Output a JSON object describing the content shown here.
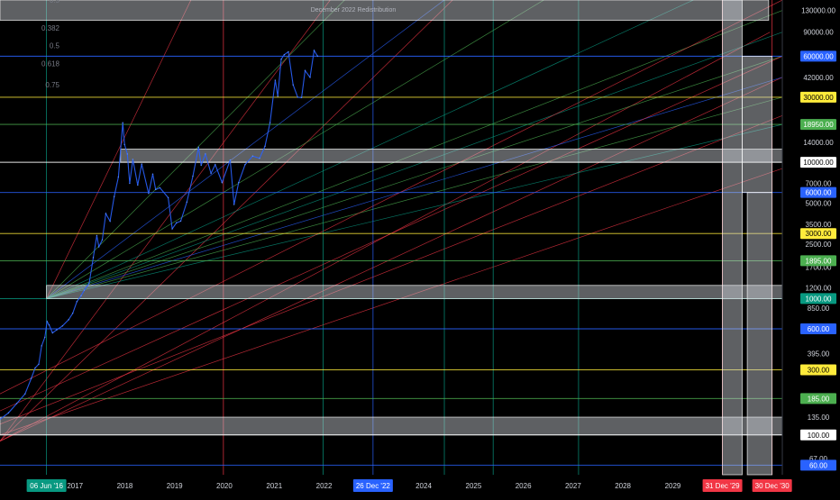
{
  "chart_data": {
    "type": "line",
    "yscale": "log",
    "title": "",
    "annotation": "December 2022 Redistribution",
    "ylim": [
      51,
      155000
    ],
    "xlim": [
      "2015-07-01",
      "2031-03-15"
    ],
    "y_ticks": [
      "130000.00",
      "90000.00",
      "60000.00",
      "42000.00",
      "30000.00",
      "18950.00",
      "14000.00",
      "10000.00",
      "7000.00",
      "6000.00",
      "5000.00",
      "3500.00",
      "3000.00",
      "2500.00",
      "1895.00",
      "1700.00",
      "1200.00",
      "1000.00",
      "850.00",
      "600.00",
      "395.00",
      "300.00",
      "185.00",
      "135.00",
      "100.00",
      "67.00",
      "60.00"
    ],
    "x_ticks": [
      {
        "label": "2017",
        "date": "2017-01-01"
      },
      {
        "label": "2018",
        "date": "2018-01-01"
      },
      {
        "label": "2019",
        "date": "2019-01-01"
      },
      {
        "label": "2020",
        "date": "2020-01-01"
      },
      {
        "label": "2021",
        "date": "2021-01-01"
      },
      {
        "label": "2022",
        "date": "2022-01-01"
      },
      {
        "label": "2024",
        "date": "2024-01-01"
      },
      {
        "label": "2025",
        "date": "2025-01-01"
      },
      {
        "label": "2026",
        "date": "2026-01-01"
      },
      {
        "label": "2027",
        "date": "2027-01-01"
      },
      {
        "label": "2028",
        "date": "2028-01-01"
      },
      {
        "label": "2029",
        "date": "2029-01-01"
      }
    ],
    "x_left_cut_label": "201",
    "x_markers": [
      {
        "label": "06 Jun '16",
        "date": "2016-06-06",
        "color": "#089981"
      },
      {
        "label": "26 Dec '22",
        "date": "2022-12-26",
        "color": "#2962ff"
      },
      {
        "label": "31 Dec '29",
        "date": "2029-12-31",
        "color": "#f23645"
      },
      {
        "label": "30 Dec '30",
        "date": "2030-12-30",
        "color": "#f23645"
      }
    ],
    "price_levels": [
      {
        "label": "60000.00",
        "value": 60000,
        "color": "#2962ff",
        "text_color": "#ffffff"
      },
      {
        "label": "30000.00",
        "value": 30000,
        "color": "#ffeb3b",
        "text_color": "#000000"
      },
      {
        "label": "18950.00",
        "value": 18950,
        "color": "#4caf50",
        "text_color": "#ffffff"
      },
      {
        "label": "10000.00",
        "value": 10000,
        "color": "#ffffff",
        "text_color": "#000000"
      },
      {
        "label": "6000.00",
        "value": 6000,
        "color": "#2962ff",
        "text_color": "#ffffff"
      },
      {
        "label": "3000.00",
        "value": 3000,
        "color": "#ffeb3b",
        "text_color": "#000000"
      },
      {
        "label": "1895.00",
        "value": 1895,
        "color": "#4caf50",
        "text_color": "#ffffff"
      },
      {
        "label": "1000.00",
        "value": 1000,
        "color": "#089981",
        "text_color": "#ffffff"
      },
      {
        "label": "600.00",
        "value": 600,
        "color": "#2962ff",
        "text_color": "#ffffff"
      },
      {
        "label": "300.00",
        "value": 300,
        "color": "#ffeb3b",
        "text_color": "#000000"
      },
      {
        "label": "185.00",
        "value": 185,
        "color": "#4caf50",
        "text_color": "#ffffff"
      },
      {
        "label": "100.00",
        "value": 100,
        "color": "#ffffff",
        "text_color": "#000000"
      },
      {
        "label": "60.00",
        "value": 60,
        "color": "#2962ff",
        "text_color": "#ffffff"
      }
    ],
    "fib_labels": [
      {
        "text": "0.5",
        "value": 155000
      },
      {
        "text": "0.382",
        "value": 97000
      },
      {
        "text": "0.5",
        "value": 72000
      },
      {
        "text": "0.618",
        "value": 53000
      },
      {
        "text": "0.75",
        "value": 37000
      }
    ],
    "zones": [
      {
        "x0": "2015-07-01",
        "x1": "2030-12-05",
        "y0": 110000,
        "y1": 155000
      },
      {
        "x0": "2017-12-01",
        "x1": "2031-03-15",
        "y0": 10000,
        "y1": 12500
      },
      {
        "x0": "2016-06-06",
        "x1": "2031-03-15",
        "y0": 1000,
        "y1": 1250
      },
      {
        "x0": "2015-07-01",
        "x1": "2031-03-15",
        "y0": 100,
        "y1": 135
      },
      {
        "x0": "2029-12-31",
        "x1": "2030-05-25",
        "y0": 51,
        "y1": 155000
      },
      {
        "x0": "2030-05-25",
        "x1": "2030-12-30",
        "y0": 6000,
        "y1": 60000
      },
      {
        "x0": "2030-07-01",
        "x1": "2030-12-30",
        "y0": 51,
        "y1": 6000
      }
    ],
    "vertical_lines": [
      {
        "date": "2016-06-06",
        "color": "#089981"
      },
      {
        "date": "2019-12-25",
        "color": "#f23645"
      },
      {
        "date": "2021-12-25",
        "color": "#089981"
      },
      {
        "date": "2022-12-26",
        "color": "#2962ff"
      },
      {
        "date": "2024-06-01",
        "color": "#089981"
      },
      {
        "date": "2025-05-25",
        "color": "#089981"
      },
      {
        "date": "2027-02-10",
        "color": "#089981"
      },
      {
        "date": "2029-12-31",
        "color": "#f23645"
      },
      {
        "date": "2030-12-30",
        "color": "#f23645"
      }
    ],
    "fan_lines": [
      {
        "x0": "2015-07-01",
        "y0": 90,
        "x1": "2022-02-15",
        "y1": 155000,
        "color": "#f23645"
      },
      {
        "x0": "2015-07-01",
        "y0": 90,
        "x1": "2024-08-01",
        "y1": 155000,
        "color": "#f23645"
      },
      {
        "x0": "2015-07-01",
        "y0": 90,
        "x1": "2030-12-15",
        "y1": 90000,
        "color": "#f23645"
      },
      {
        "x0": "2015-07-01",
        "y0": 90,
        "x1": "2031-03-15",
        "y1": 42000,
        "color": "#f23645"
      },
      {
        "x0": "2016-06-06",
        "y0": 1000,
        "x1": "2019-05-01",
        "y1": 155000,
        "color": "#f23645"
      },
      {
        "x0": "2016-06-06",
        "y0": 1000,
        "x1": "2022-06-01",
        "y1": 155000,
        "color": "#4caf50"
      },
      {
        "x0": "2016-06-06",
        "y0": 1000,
        "x1": "2024-06-01",
        "y1": 155000,
        "color": "#2962ff"
      },
      {
        "x0": "2016-06-06",
        "y0": 1000,
        "x1": "2026-06-01",
        "y1": 155000,
        "color": "#4caf50"
      },
      {
        "x0": "2016-06-06",
        "y0": 1000,
        "x1": "2029-06-01",
        "y1": 155000,
        "color": "#089981"
      },
      {
        "x0": "2016-06-06",
        "y0": 1000,
        "x1": "2031-03-15",
        "y1": 130000,
        "color": "#4caf50"
      },
      {
        "x0": "2016-06-06",
        "y0": 1000,
        "x1": "2031-03-15",
        "y1": 90000,
        "color": "#089981"
      },
      {
        "x0": "2016-06-06",
        "y0": 1000,
        "x1": "2031-03-15",
        "y1": 60000,
        "color": "#4caf50"
      },
      {
        "x0": "2016-06-06",
        "y0": 1000,
        "x1": "2031-03-15",
        "y1": 42000,
        "color": "#2962ff"
      },
      {
        "x0": "2016-06-06",
        "y0": 1000,
        "x1": "2031-03-15",
        "y1": 30000,
        "color": "#4caf50"
      },
      {
        "x0": "2016-06-06",
        "y0": 1000,
        "x1": "2031-03-15",
        "y1": 18950,
        "color": "#089981"
      },
      {
        "x0": "2015-07-01",
        "y0": 200,
        "x1": "2031-03-15",
        "y1": 155000,
        "color": "#f23645"
      },
      {
        "x0": "2015-07-01",
        "y0": 150,
        "x1": "2031-03-15",
        "y1": 60000,
        "color": "#f23645"
      },
      {
        "x0": "2015-07-01",
        "y0": 120,
        "x1": "2031-03-15",
        "y1": 22000,
        "color": "#f23645"
      },
      {
        "x0": "2015-07-01",
        "y0": 100,
        "x1": "2031-03-15",
        "y1": 9000,
        "color": "#f23645"
      }
    ],
    "price_series": [
      [
        "2015-07-01",
        130
      ],
      [
        "2015-09-01",
        145
      ],
      [
        "2015-11-01",
        170
      ],
      [
        "2016-01-01",
        200
      ],
      [
        "2016-02-15",
        260
      ],
      [
        "2016-03-15",
        310
      ],
      [
        "2016-04-10",
        330
      ],
      [
        "2016-05-01",
        450
      ],
      [
        "2016-05-25",
        520
      ],
      [
        "2016-06-10",
        680
      ],
      [
        "2016-06-25",
        640
      ],
      [
        "2016-07-20",
        560
      ],
      [
        "2016-08-20",
        590
      ],
      [
        "2016-10-01",
        630
      ],
      [
        "2016-11-15",
        700
      ],
      [
        "2016-12-15",
        780
      ],
      [
        "2017-01-15",
        950
      ],
      [
        "2017-02-15",
        1050
      ],
      [
        "2017-03-10",
        1150
      ],
      [
        "2017-04-15",
        1300
      ],
      [
        "2017-05-15",
        2000
      ],
      [
        "2017-06-10",
        2900
      ],
      [
        "2017-06-25",
        2400
      ],
      [
        "2017-07-20",
        2700
      ],
      [
        "2017-08-15",
        4200
      ],
      [
        "2017-09-15",
        3700
      ],
      [
        "2017-10-15",
        5600
      ],
      [
        "2017-11-15",
        7800
      ],
      [
        "2017-12-17",
        19500
      ],
      [
        "2017-12-30",
        13500
      ],
      [
        "2018-01-20",
        11500
      ],
      [
        "2018-02-06",
        7000
      ],
      [
        "2018-03-01",
        10500
      ],
      [
        "2018-04-06",
        6800
      ],
      [
        "2018-05-05",
        9700
      ],
      [
        "2018-06-25",
        5900
      ],
      [
        "2018-07-25",
        8200
      ],
      [
        "2018-08-15",
        6300
      ],
      [
        "2018-09-15",
        6500
      ],
      [
        "2018-11-15",
        5500
      ],
      [
        "2018-12-15",
        3250
      ],
      [
        "2019-01-15",
        3600
      ],
      [
        "2019-02-15",
        3700
      ],
      [
        "2019-04-01",
        5100
      ],
      [
        "2019-05-15",
        7900
      ],
      [
        "2019-06-26",
        12900
      ],
      [
        "2019-07-15",
        9500
      ],
      [
        "2019-08-15",
        11500
      ],
      [
        "2019-09-25",
        8300
      ],
      [
        "2019-10-26",
        9600
      ],
      [
        "2019-12-15",
        7100
      ],
      [
        "2020-02-13",
        10400
      ],
      [
        "2020-03-12",
        4900
      ],
      [
        "2020-04-15",
        7100
      ],
      [
        "2020-06-01",
        9600
      ],
      [
        "2020-07-27",
        11100
      ],
      [
        "2020-09-15",
        10700
      ],
      [
        "2020-10-25",
        13100
      ],
      [
        "2020-12-01",
        19500
      ],
      [
        "2021-01-08",
        40000
      ],
      [
        "2021-01-27",
        30500
      ],
      [
        "2021-02-21",
        57000
      ],
      [
        "2021-03-15",
        61500
      ],
      [
        "2021-04-14",
        64500
      ],
      [
        "2021-05-19",
        37000
      ],
      [
        "2021-06-22",
        30000
      ],
      [
        "2021-07-20",
        29800
      ],
      [
        "2021-08-15",
        47000
      ],
      [
        "2021-09-20",
        42000
      ],
      [
        "2021-10-20",
        66000
      ],
      [
        "2021-11-15",
        60000
      ]
    ]
  }
}
